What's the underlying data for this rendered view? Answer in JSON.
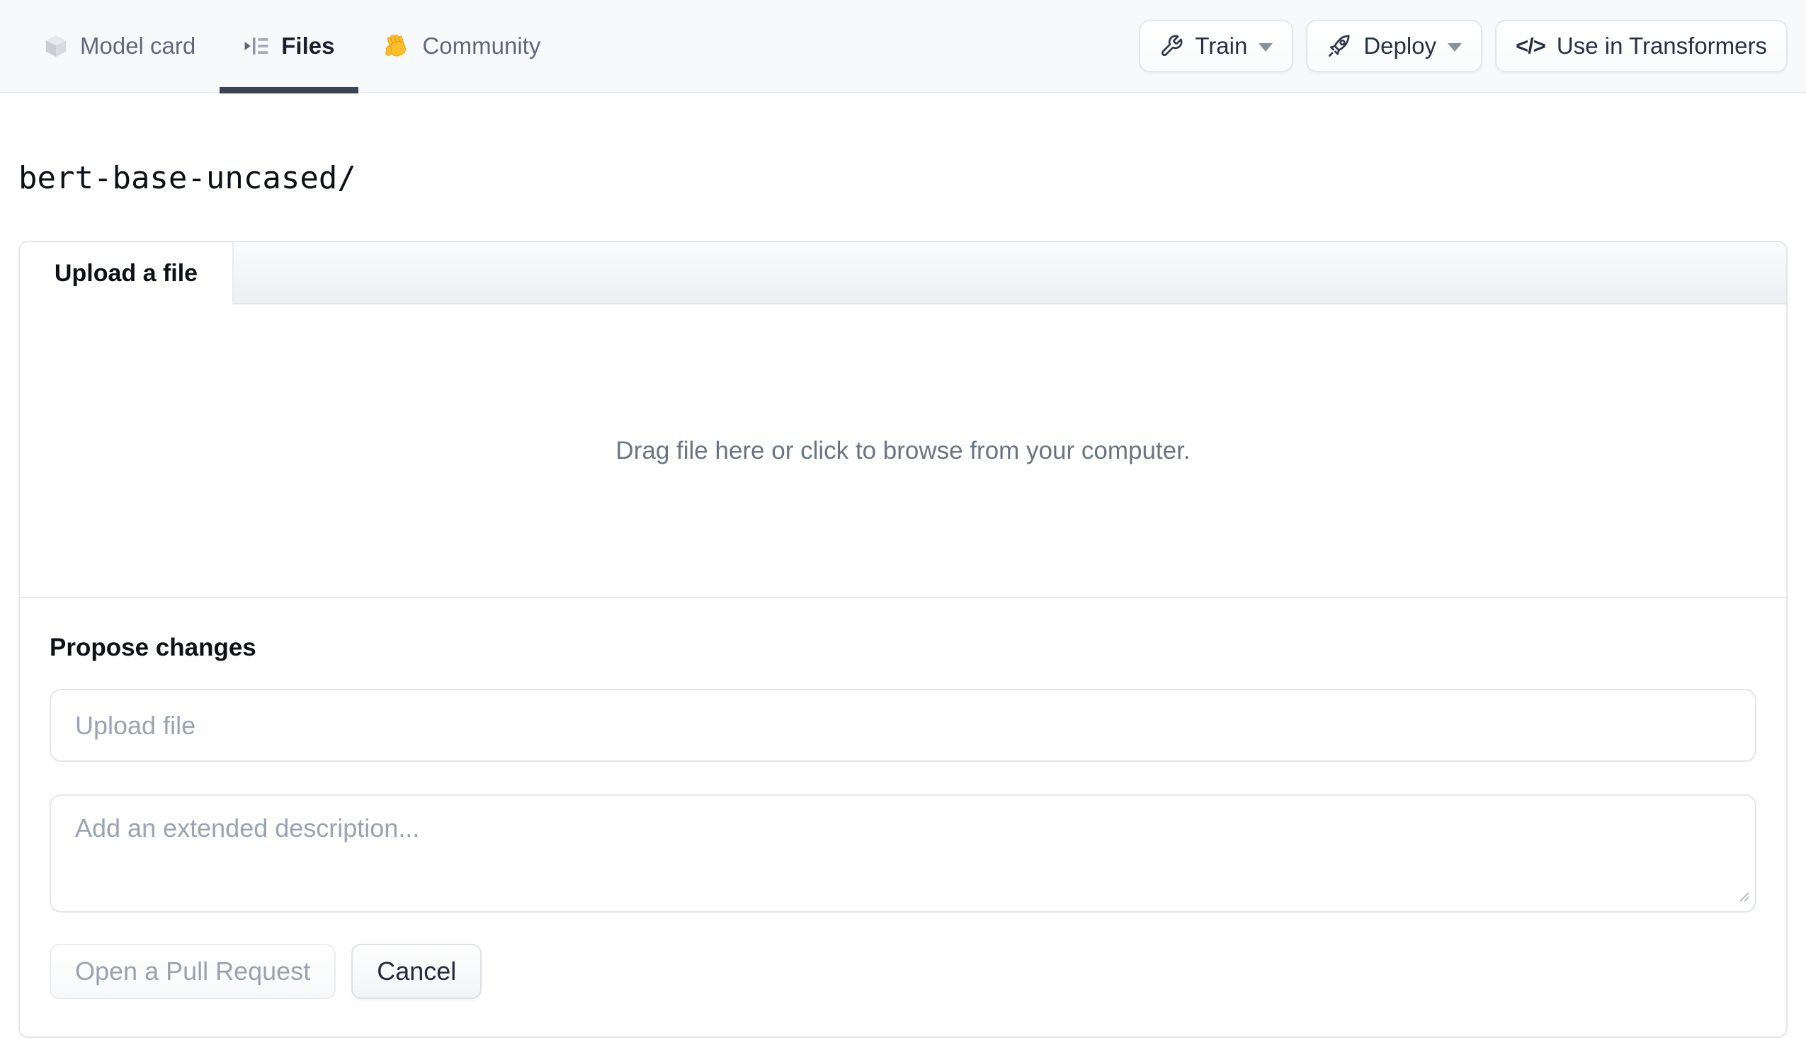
{
  "nav": {
    "tabs": [
      {
        "label": "Model card",
        "icon": "cube-icon",
        "active": false
      },
      {
        "label": "Files",
        "icon": "versions-icon",
        "active": true
      },
      {
        "label": "Community",
        "icon": "waving-hand-icon",
        "active": false
      }
    ],
    "actions": [
      {
        "label": "Train",
        "icon": "wrench-icon",
        "has_dropdown": true
      },
      {
        "label": "Deploy",
        "icon": "rocket-icon",
        "has_dropdown": true
      },
      {
        "label": "Use in Transformers",
        "icon": "code-icon",
        "code_glyph": "</>",
        "has_dropdown": false
      }
    ]
  },
  "breadcrumb": {
    "path": "bert-base-uncased/"
  },
  "upload_panel": {
    "tab_label": "Upload a file",
    "dropzone_text": "Drag file here or click to browse from your computer.",
    "propose": {
      "heading": "Propose changes",
      "filename_placeholder": "Upload file",
      "description_placeholder": "Add an extended description...",
      "submit_label": "Open a Pull Request",
      "cancel_label": "Cancel"
    }
  },
  "colors": {
    "nav_background": "#f8f9fb",
    "active_tab_underline": "#3b4454",
    "panel_border": "#e3e6ea",
    "muted_text": "#6a7483",
    "placeholder_text": "#9aa3b2",
    "dark_text": "#0d1117",
    "hand_emoji_yellow": "#fcbf29"
  }
}
